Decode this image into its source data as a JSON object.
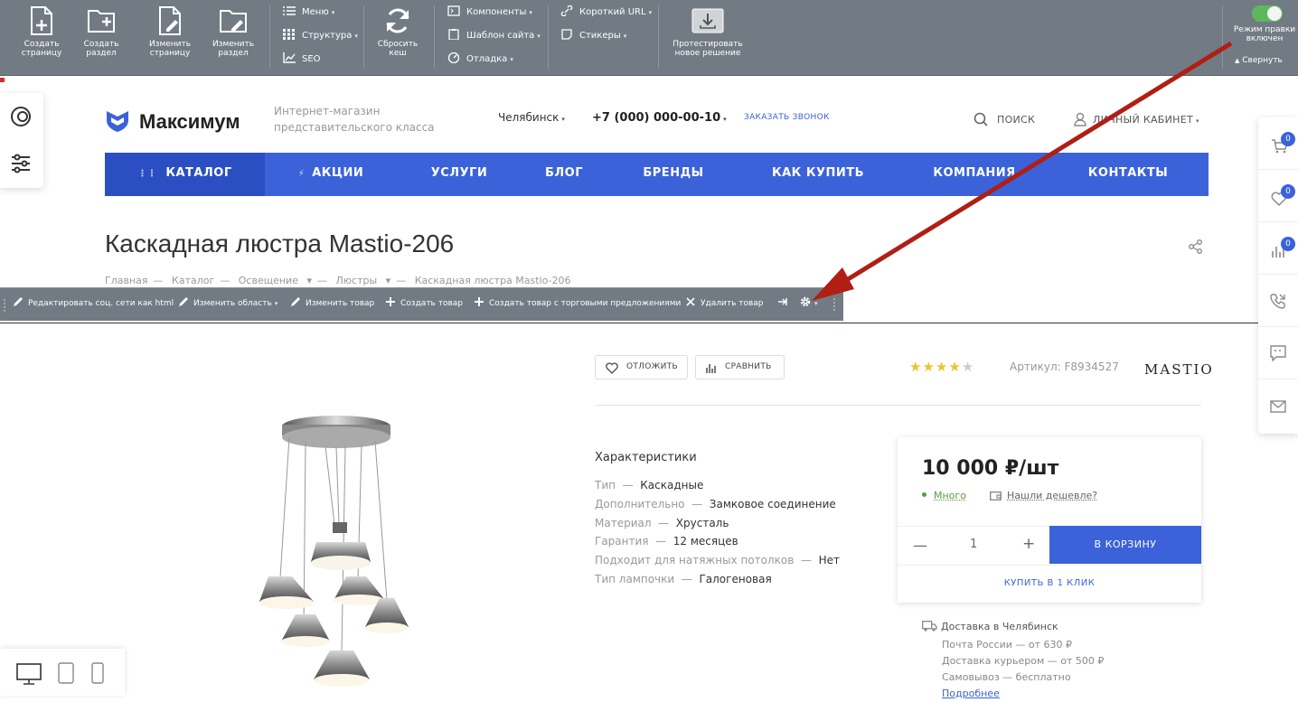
{
  "admin": {
    "buttons": [
      {
        "label": "Создать страницу",
        "icon": "create-page-icon"
      },
      {
        "label": "Создать раздел",
        "icon": "create-section-icon"
      },
      {
        "label": "Изменить страницу",
        "icon": "edit-page-icon"
      },
      {
        "label": "Изменить раздел",
        "icon": "edit-section-icon"
      },
      {
        "label": "Сбросить кеш",
        "icon": "refresh-icon"
      },
      {
        "label": "Протестировать новое решение",
        "icon": "download-box-icon"
      }
    ],
    "menu_col1": [
      "Меню",
      "Структура",
      "SEO"
    ],
    "menu_col2": [
      "Компоненты",
      "Шаблон сайта",
      "Отладка"
    ],
    "menu_col3": [
      "Короткий URL",
      "Стикеры"
    ],
    "edit_mode": "Режим правки включен",
    "collapse": "Свернуть"
  },
  "header": {
    "logo": "Максимум",
    "slogan_line1": "Интернет-магазин",
    "slogan_line2": "представительского класса",
    "city": "Челябинск",
    "phone": "+7 (000) 000-00-10",
    "callback": "ЗАКАЗАТЬ ЗВОНОК",
    "search": "ПОИСК",
    "cabinet": "ЛИЧНЫЙ КАБИНЕТ"
  },
  "nav": [
    "КАТАЛОГ",
    "АКЦИИ",
    "УСЛУГИ",
    "БЛОГ",
    "БРЕНДЫ",
    "КАК КУПИТЬ",
    "КОМПАНИЯ",
    "КОНТАКТЫ"
  ],
  "page": {
    "title": "Каскадная люстра Mastio-206",
    "breadcrumb": [
      "Главная",
      "Каталог",
      "Освещение",
      "Люстры",
      "Каскадная люстра Mastio-206"
    ]
  },
  "edit_toolbar": {
    "items": [
      "Редактировать соц. сети как html",
      "Изменить область",
      "Изменить товар",
      "Создать товар",
      "Создать товар с торговыми предложениями",
      "Удалить товар"
    ]
  },
  "product": {
    "put_aside": "ОТЛОЖИТЬ",
    "compare": "СРАВНИТЬ",
    "rating": 4,
    "rating_max": 5,
    "article": "Артикул: F8934527",
    "brand": "MASTIO",
    "characteristics_title": "Характеристики",
    "characteristics": [
      {
        "name": "Тип",
        "value": "Каскадные"
      },
      {
        "name": "Дополнительно",
        "value": "Замковое соединение"
      },
      {
        "name": "Материал",
        "value": "Хрусталь"
      },
      {
        "name": "Гарантия",
        "value": "12 месяцев"
      },
      {
        "name": "Подходит для натяжных потолков",
        "value": "Нет"
      },
      {
        "name": "Тип лампочки",
        "value": "Галогеновая"
      }
    ],
    "price": "10 000 ₽/шт",
    "stock": "Много",
    "cheaper": "Нашли дешевле?",
    "quantity": "1",
    "to_cart": "В КОРЗИНУ",
    "one_click": "КУПИТЬ В 1 КЛИК",
    "delivery_title": "Доставка в Челябинск",
    "delivery_lines": [
      "Почта России — от 630 ₽",
      "Доставка курьером — от 500 ₽",
      "Самовывоз — бесплатно"
    ],
    "delivery_more": "Подробнее"
  },
  "rightbar": {
    "cart_count": "0",
    "favorites_count": "0",
    "compare_count": "0"
  },
  "colors": {
    "accent": "#3b62d9",
    "admin_bg": "#727b84",
    "arrow": "#b01e14",
    "star": "#f2c12e"
  }
}
